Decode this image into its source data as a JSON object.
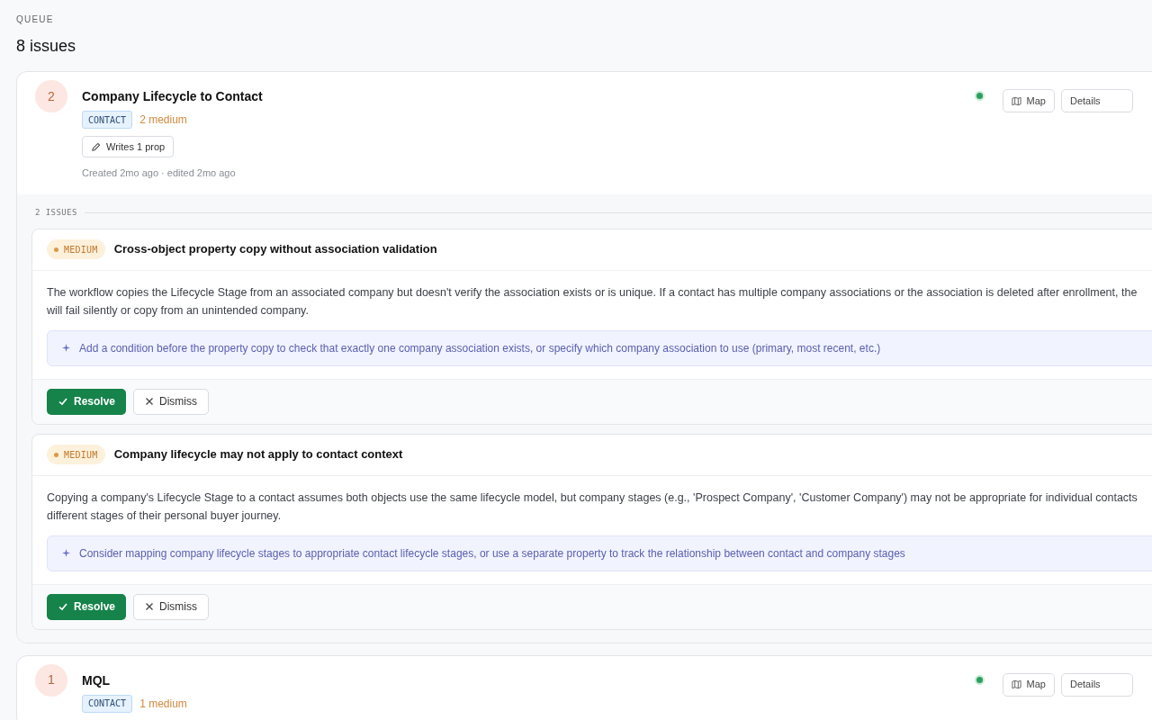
{
  "header": {
    "eyebrow": "QUEUE",
    "title": "8 issues"
  },
  "workflows": [
    {
      "count": "2",
      "name": "Company Lifecycle to Contact",
      "object": "CONTACT",
      "severity_summary": "2 medium",
      "writes": "Writes 1 prop",
      "meta": "Created 2mo ago · edited 2mo ago",
      "active": true,
      "map_label": "Map",
      "details_label": "Details",
      "issues_label": "2 ISSUES",
      "issues": [
        {
          "severity": "MEDIUM",
          "title": "Cross-object property copy without association validation",
          "description_lines": [
            "The workflow copies the Lifecycle Stage from an associated company but doesn't verify the association exists or is unique. If a contact has multiple company associations or the association is deleted after enrollment, the",
            "will fail silently or copy from an unintended company."
          ],
          "suggestion": "Add a condition before the property copy to check that exactly one company association exists, or specify which company association to use (primary, most recent, etc.)",
          "resolve_label": "Resolve",
          "dismiss_label": "Dismiss"
        },
        {
          "severity": "MEDIUM",
          "title": "Company lifecycle may not apply to contact context",
          "description_lines": [
            "Copying a company's Lifecycle Stage to a contact assumes both objects use the same lifecycle model, but company stages (e.g., 'Prospect Company', 'Customer Company') may not be appropriate for individual contacts",
            "different stages of their personal buyer journey."
          ],
          "suggestion": "Consider mapping company lifecycle stages to appropriate contact lifecycle stages, or use a separate property to track the relationship between contact and company stages",
          "resolve_label": "Resolve",
          "dismiss_label": "Dismiss"
        }
      ]
    },
    {
      "count": "1",
      "name": "MQL",
      "object": "CONTACT",
      "severity_summary": "1 medium",
      "active": true,
      "map_label": "Map",
      "details_label": "Details"
    }
  ]
}
